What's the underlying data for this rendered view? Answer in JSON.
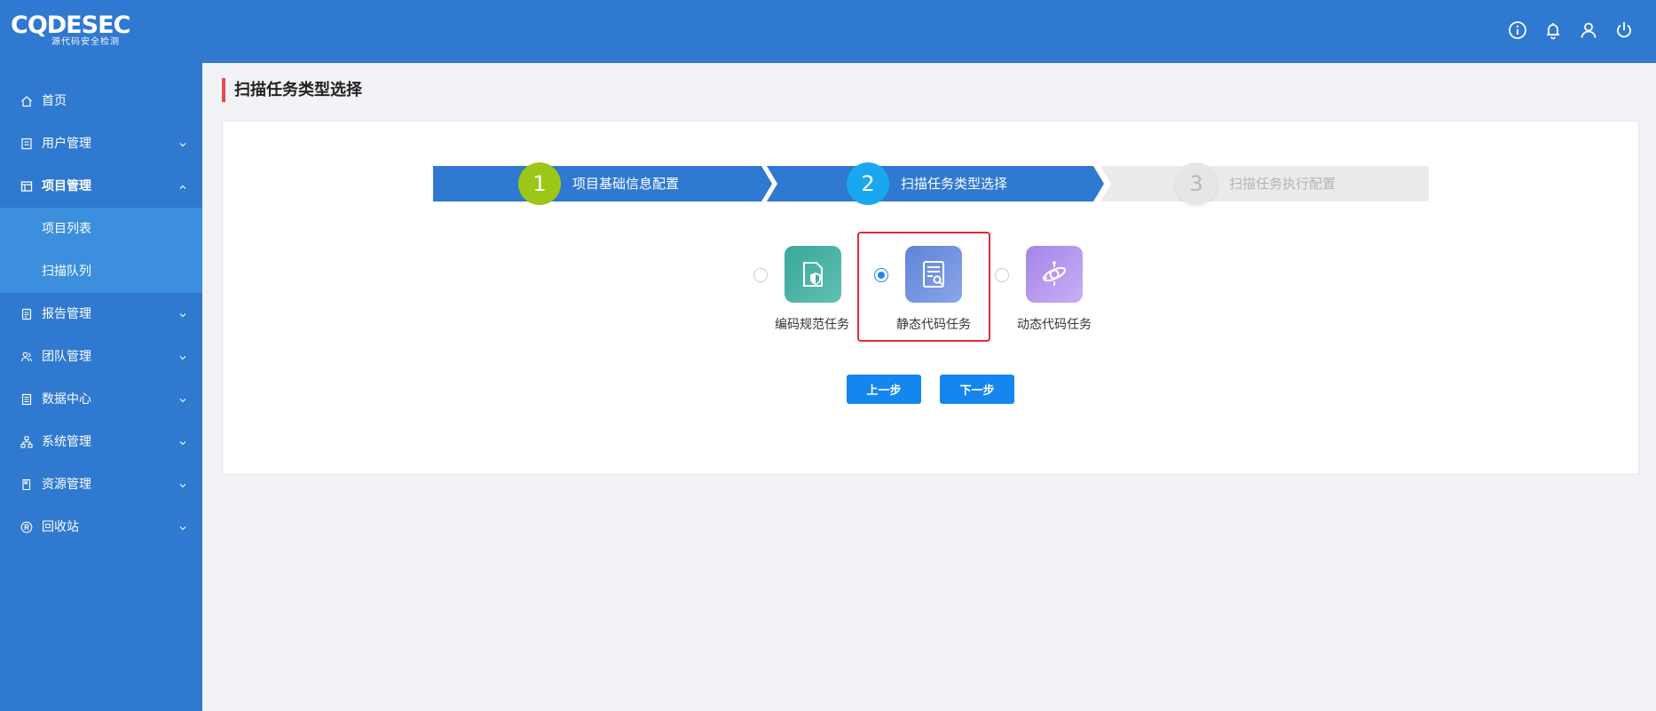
{
  "brand": {
    "logo_main": "CQDESEC",
    "logo_sub": "源代码安全检测"
  },
  "header": {
    "icons": [
      "info-icon",
      "bell-icon",
      "user-icon",
      "power-icon"
    ]
  },
  "sidebar": {
    "items": [
      {
        "label": "首页",
        "icon": "home-icon"
      },
      {
        "label": "用户管理",
        "icon": "user-manage-icon"
      },
      {
        "label": "项目管理",
        "icon": "project-icon",
        "expanded": true
      },
      {
        "label": "报告管理",
        "icon": "report-icon"
      },
      {
        "label": "团队管理",
        "icon": "team-icon"
      },
      {
        "label": "数据中心",
        "icon": "data-icon"
      },
      {
        "label": "系统管理",
        "icon": "system-icon"
      },
      {
        "label": "资源管理",
        "icon": "resource-icon"
      },
      {
        "label": "回收站",
        "icon": "recycle-icon"
      }
    ],
    "sub_items": [
      {
        "label": "项目列表"
      },
      {
        "label": "扫描队列"
      }
    ]
  },
  "page": {
    "title": "扫描任务类型选择"
  },
  "steps": [
    {
      "number": "1",
      "label": "项目基础信息配置",
      "state": "done"
    },
    {
      "number": "2",
      "label": "扫描任务类型选择",
      "state": "current"
    },
    {
      "number": "3",
      "label": "扫描任务执行配置",
      "state": "pending"
    }
  ],
  "task_types": [
    {
      "label": "编码规范任务",
      "selected": false,
      "icon": "shield-doc-icon"
    },
    {
      "label": "静态代码任务",
      "selected": true,
      "icon": "doc-search-icon"
    },
    {
      "label": "动态代码任务",
      "selected": false,
      "icon": "orbit-icon"
    }
  ],
  "buttons": {
    "prev": "上一步",
    "next": "下一步"
  },
  "colors": {
    "header_bg": "#3079d0",
    "step_done_circle": "#9cc716",
    "step_current_circle": "#19a8f0",
    "step_bar": "#3079d0",
    "step_pending": "#ebebeb",
    "highlight": "#e12a38",
    "button": "#1486ee"
  }
}
